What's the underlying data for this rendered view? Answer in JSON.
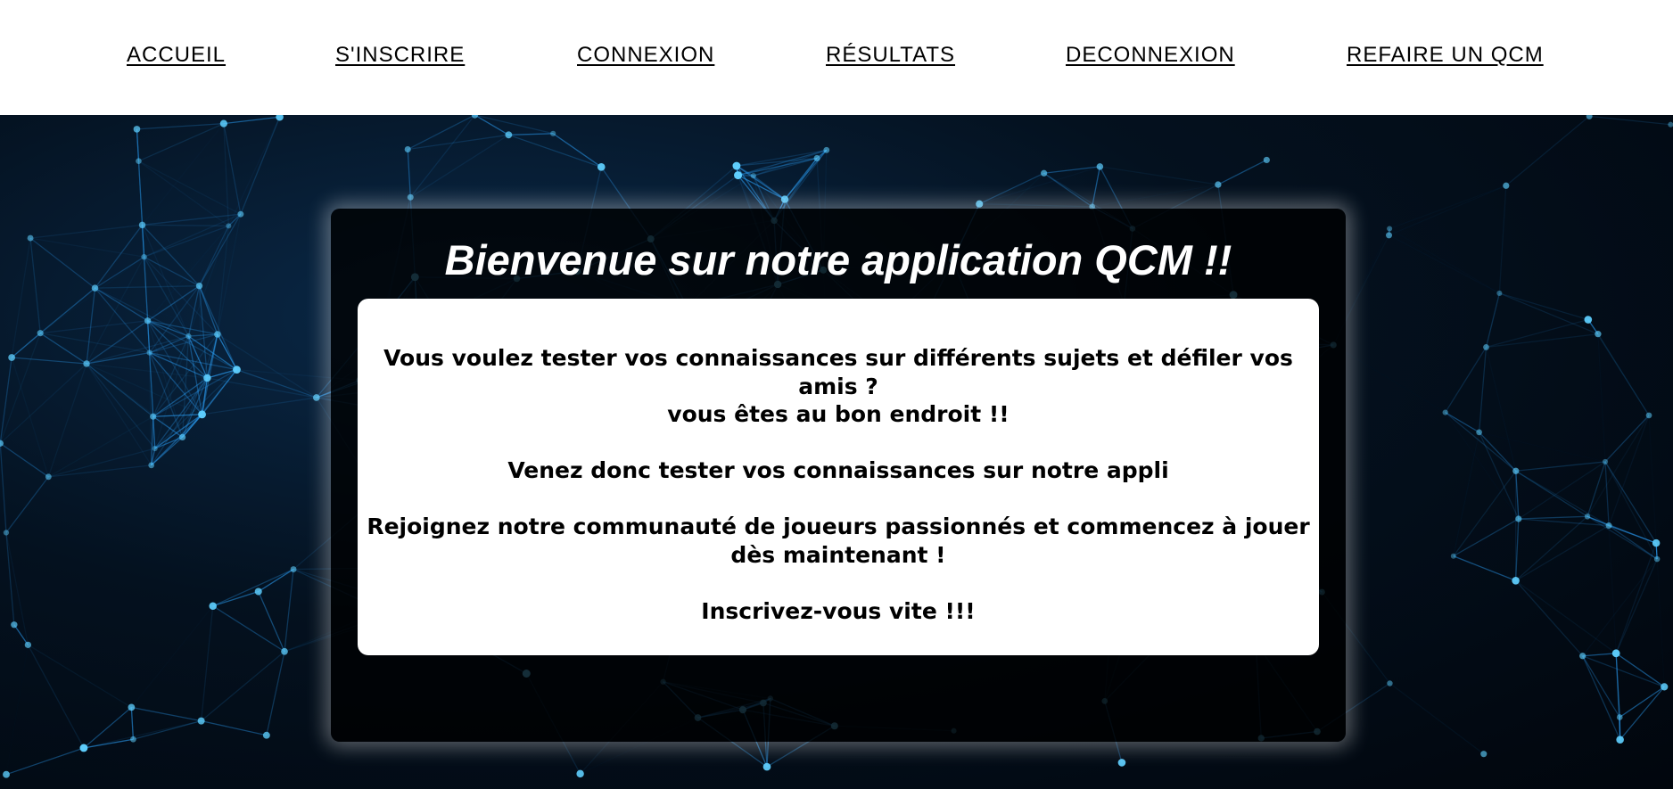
{
  "nav": {
    "items": [
      {
        "label": "ACCUEIL"
      },
      {
        "label": "S'INSCRIRE"
      },
      {
        "label": "CONNEXION"
      },
      {
        "label": "RÉSULTATS"
      },
      {
        "label": "DECONNEXION"
      },
      {
        "label": "REFAIRE UN QCM"
      }
    ]
  },
  "hero": {
    "title": "Bienvenue sur notre application QCM !!",
    "paragraphs": [
      "Vous voulez tester vos connaissances sur différents sujets et défiler vos amis ?",
      "vous êtes au bon endroit !!",
      "Venez donc tester vos connaissances sur notre appli",
      "Rejoignez notre communauté de joueurs passionnés et commencez à jouer dès maintenant !",
      "Inscrivez-vous vite !!!"
    ]
  },
  "colors": {
    "nav_background": "#ffffff",
    "network_lines": "#2a9df4",
    "network_nodes": "#5fd0ff",
    "card_background": "#000000",
    "content_background": "#ffffff"
  }
}
